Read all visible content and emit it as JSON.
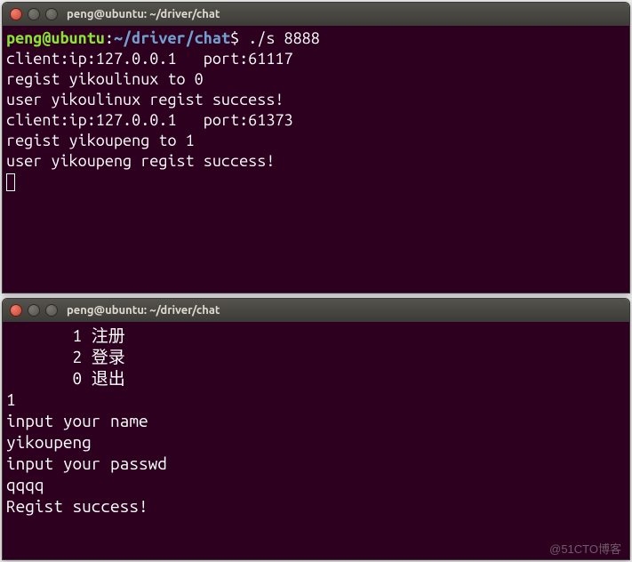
{
  "window1": {
    "title": "peng@ubuntu: ~/driver/chat",
    "prompt": {
      "userhost": "peng@ubuntu",
      "path": "~/driver/chat",
      "command": "./s 8888"
    },
    "lines": [
      "client:ip:127.0.0.1   port:61117",
      "regist yikoulinux to 0",
      "user yikoulinux regist success!",
      "client:ip:127.0.0.1   port:61373",
      "regist yikoupeng to 1",
      "user yikoupeng regist success!"
    ]
  },
  "window2": {
    "title": "peng@ubuntu: ~/driver/chat",
    "menu": [
      "       1 注册",
      "       2 登录",
      "       0 退出"
    ],
    "lines": [
      "1",
      "input your name",
      "yikoupeng",
      "input your passwd",
      "qqqq",
      "Regist success!"
    ]
  },
  "watermark": "@51CTO博客"
}
